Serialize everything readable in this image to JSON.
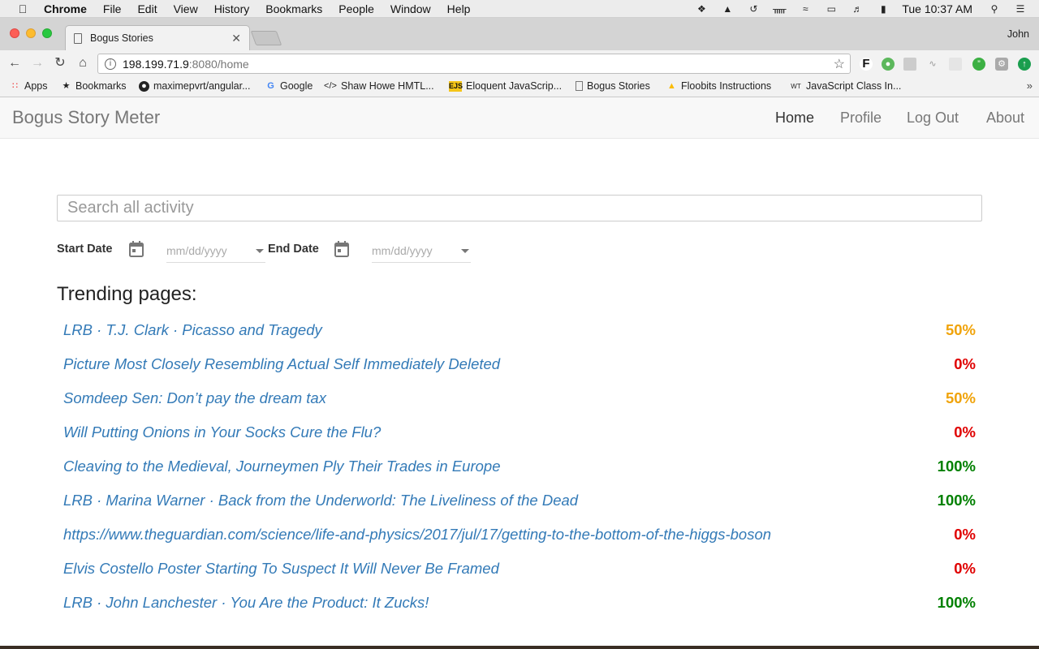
{
  "menubar": {
    "app": "Chrome",
    "items": [
      "File",
      "Edit",
      "View",
      "History",
      "Bookmarks",
      "People",
      "Window",
      "Help"
    ],
    "clock": "Tue 10:37 AM"
  },
  "browser": {
    "tab_title": "Bogus Stories",
    "profile": "John",
    "url_host": "198.199.71.9",
    "url_rest": ":8080/home",
    "bookmarks": [
      {
        "label": "Apps",
        "icon": "apps-grid-icon"
      },
      {
        "label": "Bookmarks",
        "icon": "star-icon"
      },
      {
        "label": "maximepvrt/angular...",
        "icon": "github-icon"
      },
      {
        "label": "Google",
        "icon": "google-icon"
      },
      {
        "label": "Shaw Howe HMTL...",
        "icon": "code-icon"
      },
      {
        "label": "Eloquent JavaScrip...",
        "icon": "ejs-icon"
      },
      {
        "label": "Bogus Stories",
        "icon": "page-icon"
      },
      {
        "label": "Floobits Instructions",
        "icon": "drive-icon"
      },
      {
        "label": "JavaScript Class In...",
        "icon": "wt-icon"
      }
    ]
  },
  "nav": {
    "brand": "Bogus Story Meter",
    "links": [
      "Home",
      "Profile",
      "Log Out",
      "About"
    ]
  },
  "search": {
    "placeholder": "Search all activity"
  },
  "filters": {
    "start_label": "Start Date",
    "end_label": "End Date",
    "date_placeholder": "mm/dd/yyyy"
  },
  "trending": {
    "heading": "Trending pages:",
    "colors": {
      "orange": "#f0a30a",
      "red": "#e00000",
      "green": "#008000"
    },
    "items": [
      {
        "title": "LRB · T.J. Clark · Picasso and Tragedy",
        "percent": "50%",
        "color": "#f0a30a"
      },
      {
        "title": "Picture Most Closely Resembling Actual Self Immediately Deleted",
        "percent": "0%",
        "color": "#e00000"
      },
      {
        "title": "Somdeep Sen: Don’t pay the dream tax",
        "percent": "50%",
        "color": "#f0a30a"
      },
      {
        "title": "Will Putting Onions in Your Socks Cure the Flu?",
        "percent": "0%",
        "color": "#e00000"
      },
      {
        "title": "Cleaving to the Medieval, Journeymen Ply Their Trades in Europe",
        "percent": "100%",
        "color": "#008000"
      },
      {
        "title": "LRB · Marina Warner · Back from the Underworld: The Liveliness of the Dead",
        "percent": "100%",
        "color": "#008000"
      },
      {
        "title": "https://www.theguardian.com/science/life-and-physics/2017/jul/17/getting-to-the-bottom-of-the-higgs-boson",
        "percent": "0%",
        "color": "#e00000"
      },
      {
        "title": "Elvis Costello Poster Starting To Suspect It Will Never Be Framed",
        "percent": "0%",
        "color": "#e00000"
      },
      {
        "title": "LRB · John Lanchester · You Are the Product: It Zucks!",
        "percent": "100%",
        "color": "#008000"
      }
    ]
  }
}
